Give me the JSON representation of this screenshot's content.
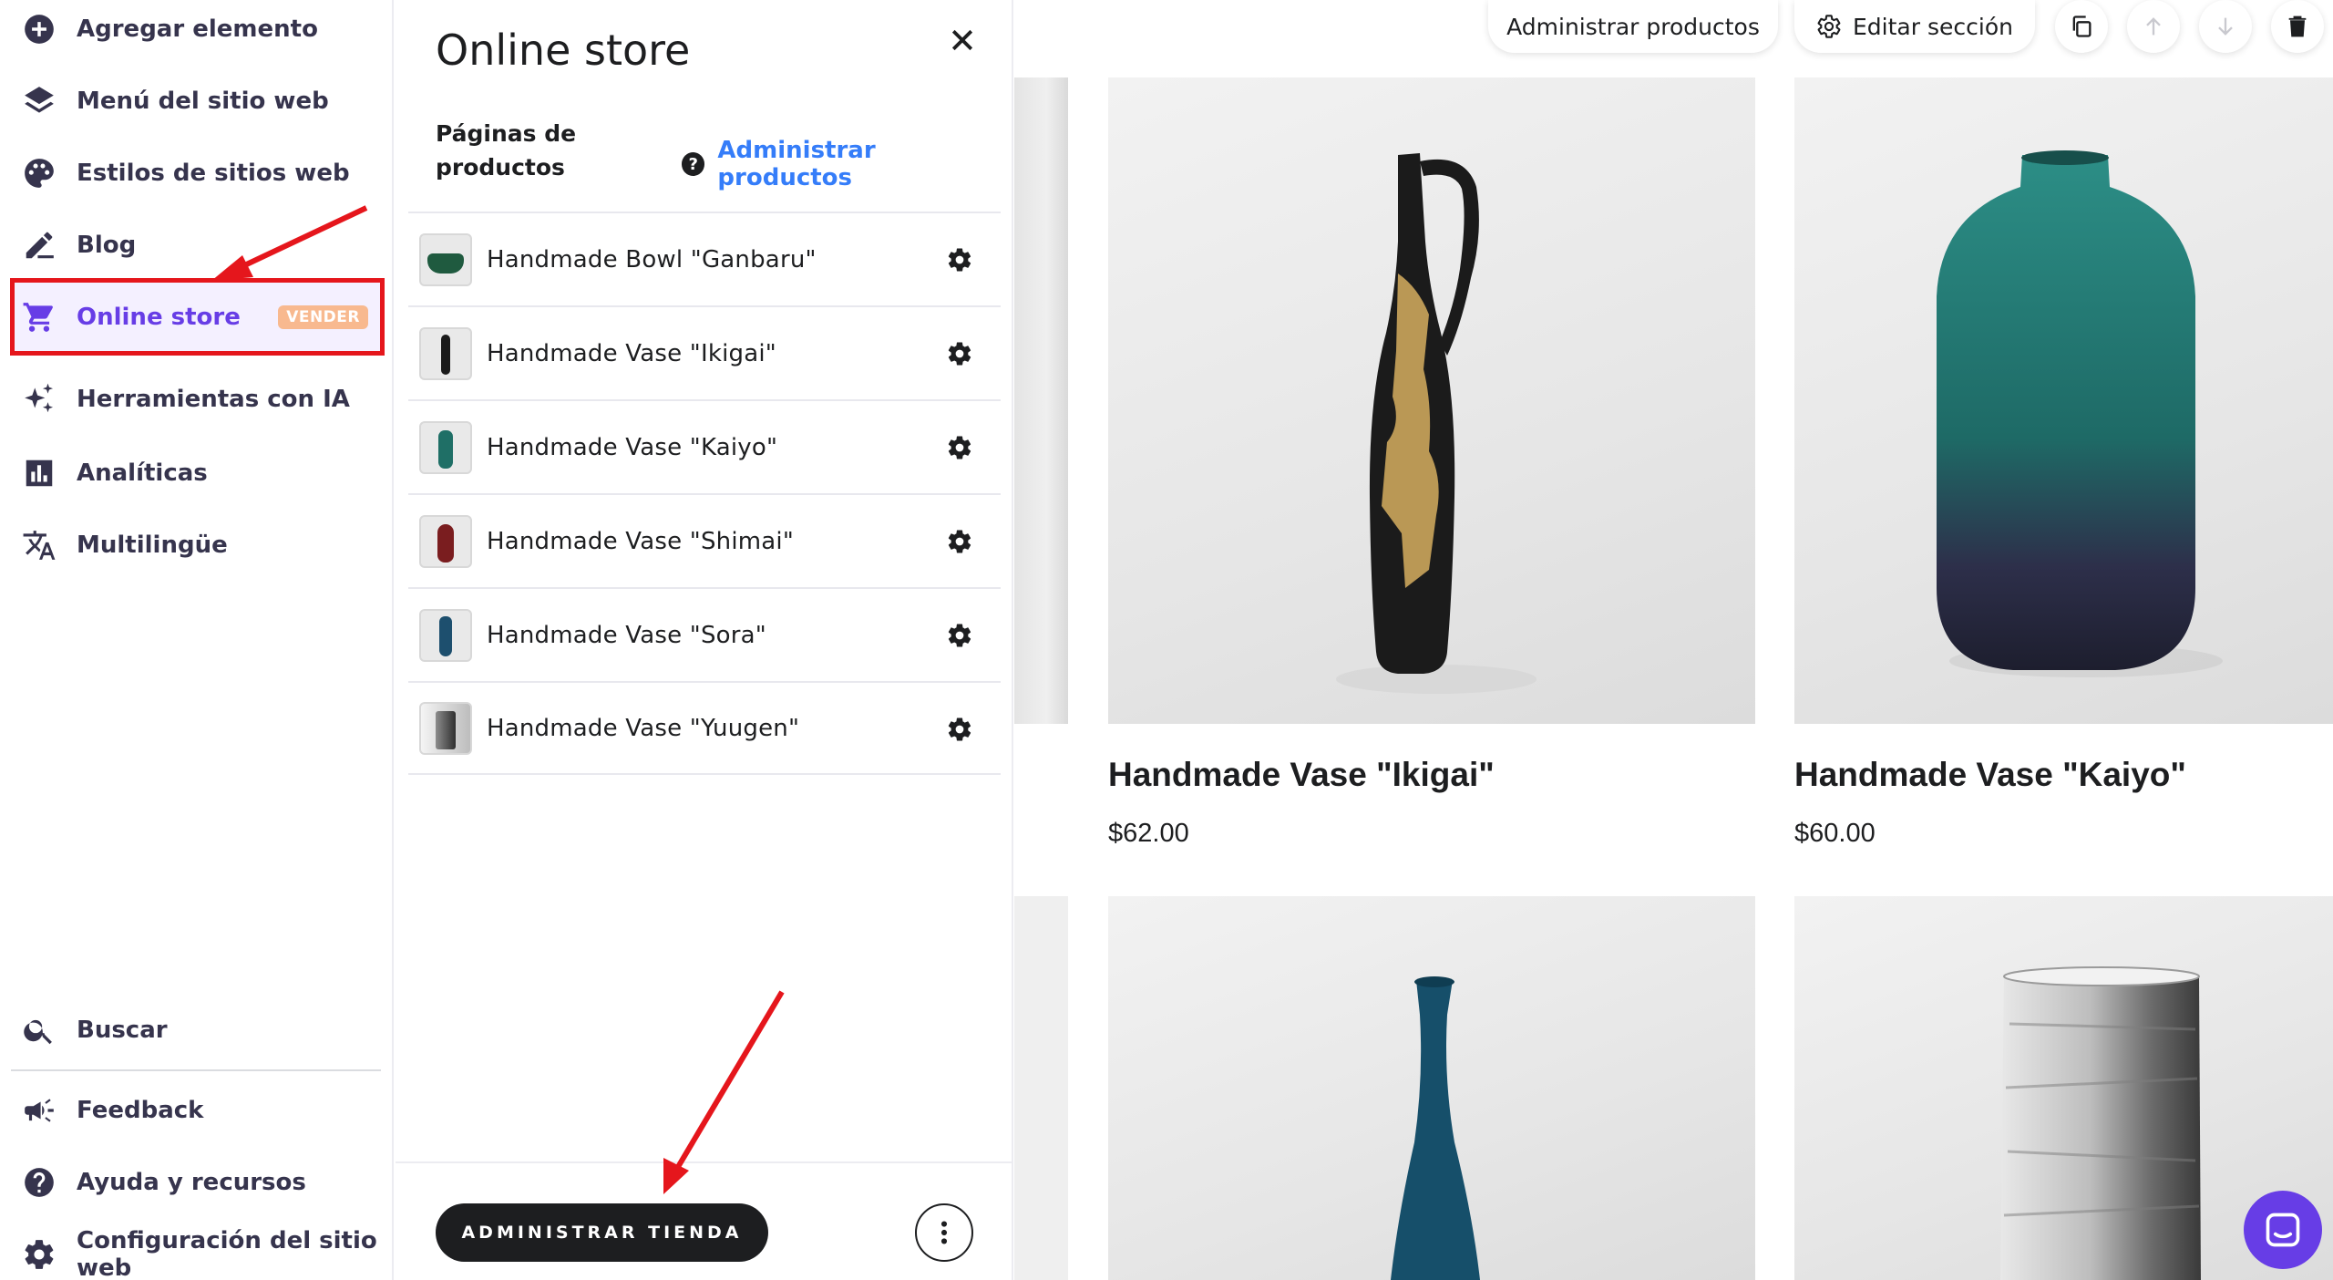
{
  "sidebar": {
    "top_items": [
      {
        "label": "Agregar elemento",
        "icon": "add-circle-icon"
      },
      {
        "label": "Menú del sitio web",
        "icon": "layers-icon"
      },
      {
        "label": "Estilos de sitios web",
        "icon": "palette-icon"
      },
      {
        "label": "Blog",
        "icon": "edit-pen-icon"
      },
      {
        "label": "Online store",
        "icon": "cart-icon",
        "badge": "VENDER",
        "active": true
      },
      {
        "label": "Herramientas con IA",
        "icon": "sparkles-icon"
      },
      {
        "label": "Analíticas",
        "icon": "bar-chart-icon"
      },
      {
        "label": "Multilingüe",
        "icon": "translate-icon"
      }
    ],
    "bottom_items": [
      {
        "label": "Buscar",
        "icon": "search-icon"
      },
      {
        "label": "Feedback",
        "icon": "megaphone-icon"
      },
      {
        "label": "Ayuda y recursos",
        "icon": "help-icon"
      },
      {
        "label": "Configuración del sitio web",
        "icon": "gear-icon"
      }
    ]
  },
  "panel": {
    "title": "Online store",
    "pages_heading": "Páginas de productos",
    "manage_link": "Administrar productos",
    "products": [
      {
        "name": "Handmade Bowl \"Ganbaru\"",
        "thumb_color": "#1f5a3f"
      },
      {
        "name": "Handmade Vase \"Ikigai\"",
        "thumb_color": "#1a1a1a"
      },
      {
        "name": "Handmade Vase \"Kaiyo\"",
        "thumb_color": "#1f6f66"
      },
      {
        "name": "Handmade Vase \"Shimai\"",
        "thumb_color": "#7a1d1f"
      },
      {
        "name": "Handmade Vase \"Sora\"",
        "thumb_color": "#1d4f6e"
      },
      {
        "name": "Handmade Vase \"Yuugen\"",
        "thumb_color": "#3a3a3a"
      }
    ],
    "admin_button": "ADMINISTRAR TIENDA"
  },
  "toolbar": {
    "manage_products": "Administrar productos",
    "edit_section": "Editar sección"
  },
  "preview": {
    "cards": [
      {
        "title": "Handmade Vase \"Ikigai\"",
        "price": "$62.00"
      },
      {
        "title": "Handmade Vase \"Kaiyo\"",
        "price": "$60.00"
      }
    ]
  },
  "colors": {
    "accent": "#673de6",
    "link": "#357df9",
    "badge": "#f8b98f",
    "annotation": "#e5161c"
  }
}
